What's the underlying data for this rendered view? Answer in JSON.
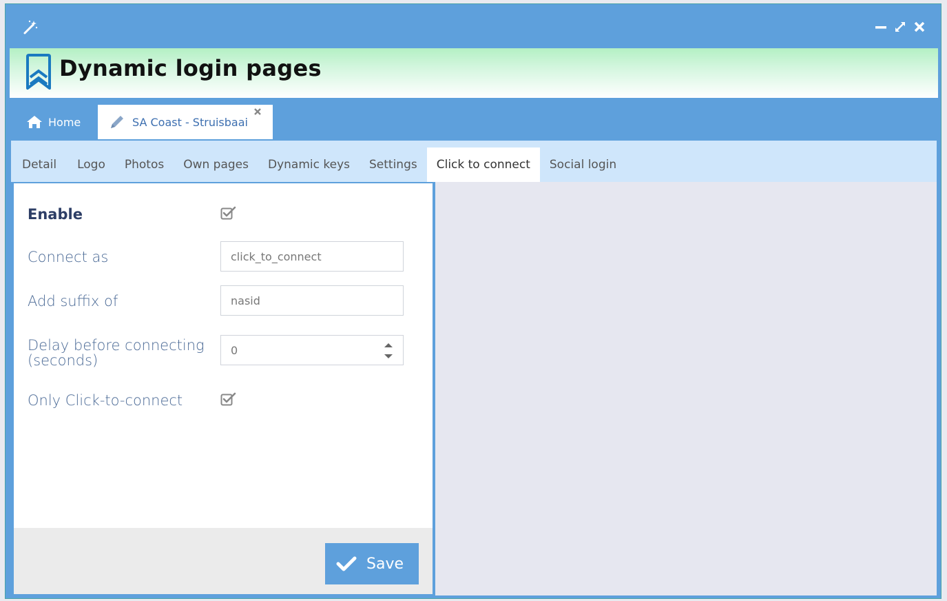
{
  "app": {
    "title": "Dynamic login pages"
  },
  "window_controls": {
    "icons": [
      "minimize-icon",
      "maximize-icon",
      "close-icon"
    ]
  },
  "tabs": {
    "home_label": "Home",
    "record_label": "SA Coast - Struisbaai"
  },
  "subtabs": [
    {
      "label": "Detail",
      "active": false
    },
    {
      "label": "Logo",
      "active": false
    },
    {
      "label": "Photos",
      "active": false
    },
    {
      "label": "Own pages",
      "active": false
    },
    {
      "label": "Dynamic keys",
      "active": false
    },
    {
      "label": "Settings",
      "active": false
    },
    {
      "label": "Click to connect",
      "active": true
    },
    {
      "label": "Social login",
      "active": false
    }
  ],
  "form": {
    "enable_label": "Enable",
    "enable_checked": true,
    "connect_as_label": "Connect as",
    "connect_as_value": "click_to_connect",
    "suffix_label": "Add suffix of",
    "suffix_value": "nasid",
    "delay_label_line1": "Delay before connecting",
    "delay_label_line2": "(seconds)",
    "delay_value": "0",
    "only_ctc_label": "Only Click-to-connect",
    "only_ctc_checked": true
  },
  "footer": {
    "save_label": "Save"
  },
  "colors": {
    "window_blue": "#5ea0dc",
    "subtab_bar": "#cfe6fb",
    "header_green": "#b4f0c4",
    "label_blue": "#4b6a96"
  }
}
